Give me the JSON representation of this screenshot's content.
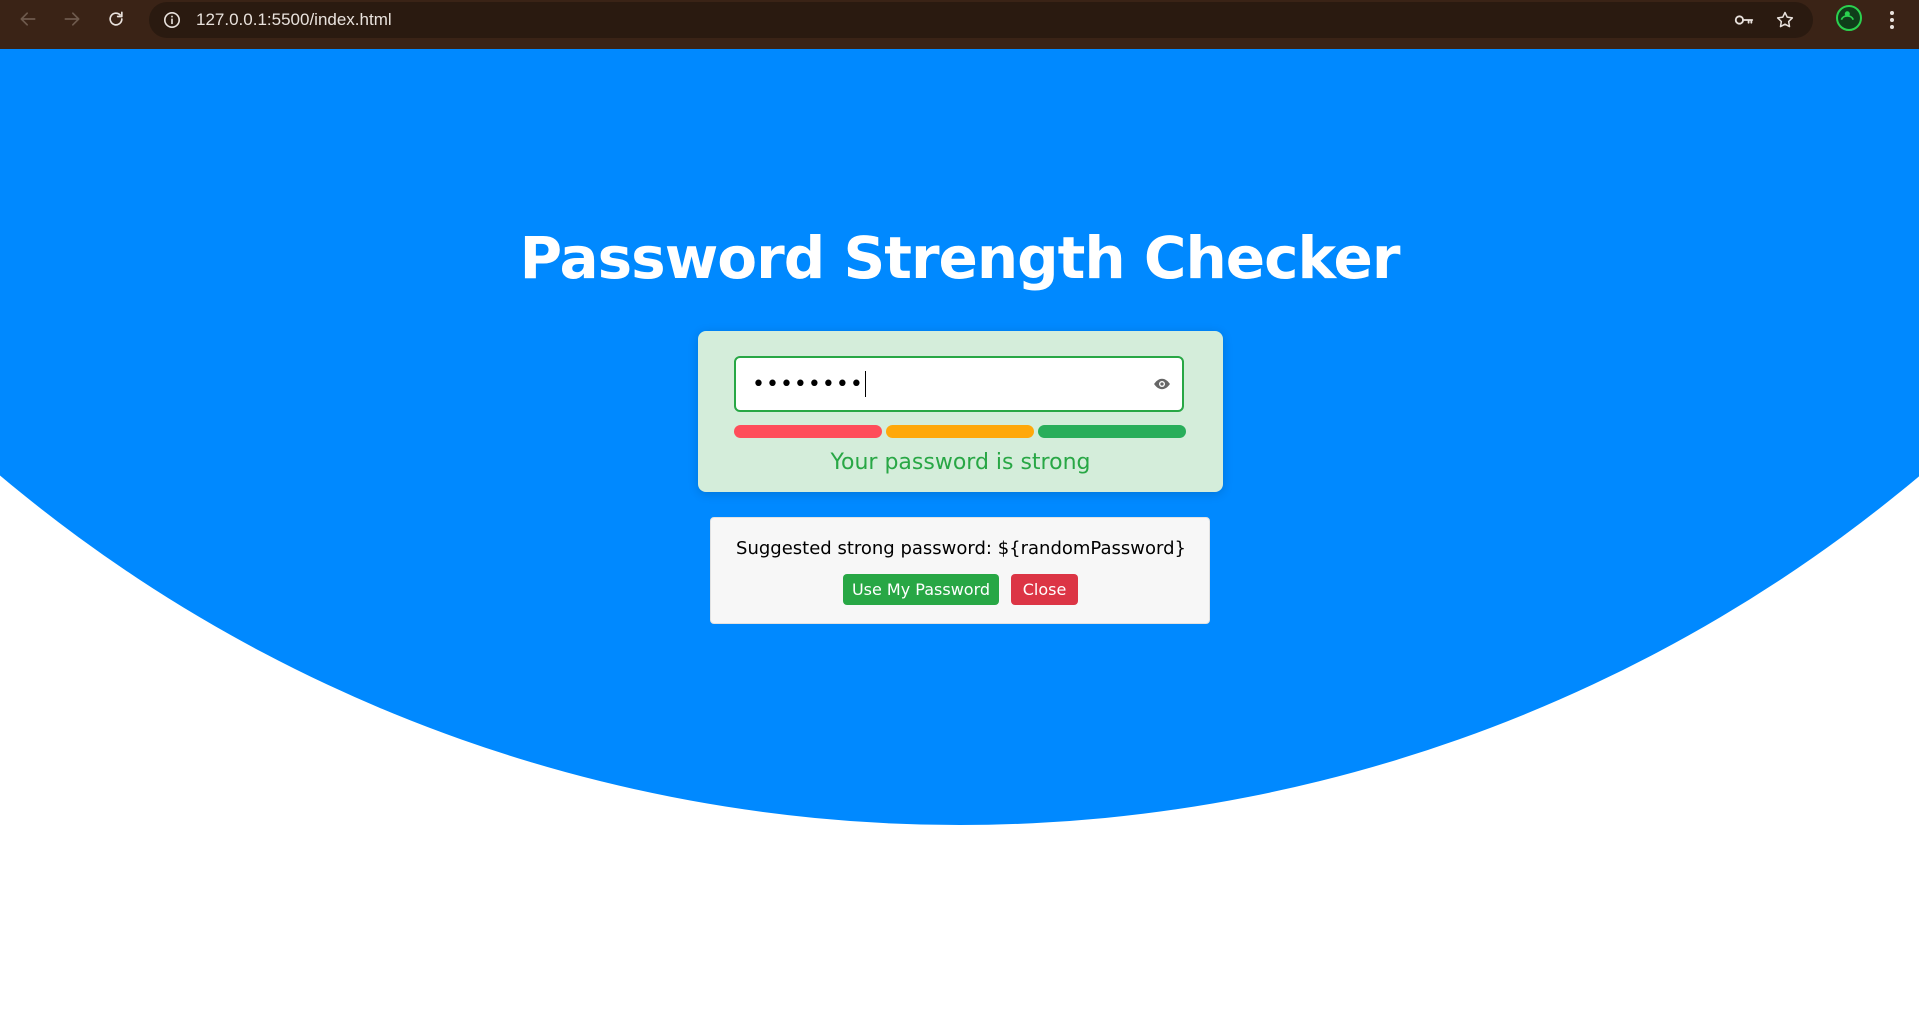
{
  "browser": {
    "url": "127.0.0.1:5500/index.html",
    "icons": {
      "back": "arrow-left-icon",
      "forward": "arrow-right-icon",
      "reload": "reload-icon",
      "site_info": "info-icon",
      "password_manager": "key-icon",
      "bookmark": "star-icon",
      "menu": "more-vertical-icon"
    }
  },
  "page": {
    "title": "Password Strength Checker",
    "colors": {
      "background": "#0089ff",
      "card": "#d4edda",
      "strong": "#28a745",
      "bar_weak": "#ff4d5a",
      "bar_medium": "#ffa80a",
      "bar_strong": "#28ae5a"
    }
  },
  "checker": {
    "password_value": "••••••••",
    "strength_level": "strong",
    "strength_message": "Your password is strong",
    "toggle_icon": "eye-icon"
  },
  "suggestion": {
    "text": "Suggested strong password: ${randomPassword}",
    "use_button": "Use My Password",
    "close_button": "Close"
  }
}
